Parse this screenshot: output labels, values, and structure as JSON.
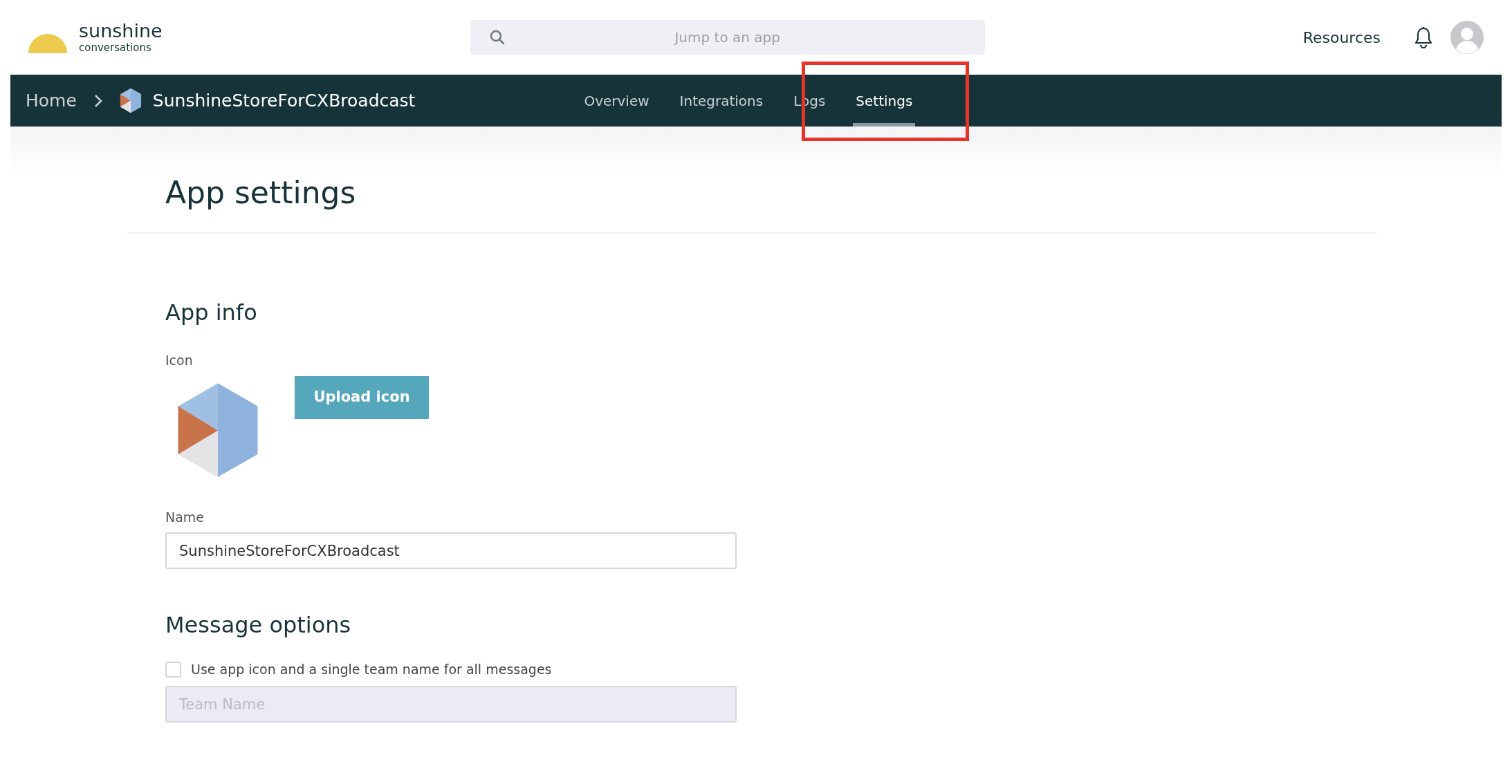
{
  "brand": {
    "name": "sunshine",
    "tagline": "conversations"
  },
  "search": {
    "placeholder": "Jump to an app"
  },
  "header_links": [
    "Resources"
  ],
  "breadcrumb": {
    "home": "Home",
    "app": "SunshineStoreForCXBroadcast"
  },
  "tabs": [
    {
      "label": "Overview",
      "selected": false,
      "highlighted": false
    },
    {
      "label": "Integrations",
      "selected": false,
      "highlighted": false
    },
    {
      "label": "Logs",
      "selected": false,
      "highlighted": false
    },
    {
      "label": "Settings",
      "selected": true,
      "highlighted": true
    }
  ],
  "page_title": "App settings",
  "app_info": {
    "heading": "App info",
    "icon_label": "Icon",
    "upload_button": "Upload icon",
    "name_label": "Name",
    "name_value": "SunshineStoreForCXBroadcast"
  },
  "message_options": {
    "heading": "Message options",
    "checkbox": {
      "label": "Use app icon and a single team name for all messages",
      "checked": false
    },
    "team_name": {
      "placeholder": "Team Name",
      "disabled": true
    }
  }
}
